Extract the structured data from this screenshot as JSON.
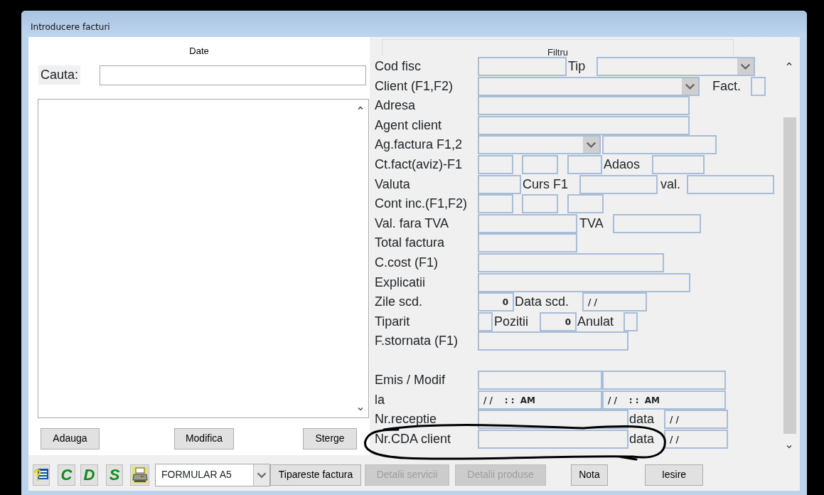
{
  "window": {
    "title": "Introducere facturi"
  },
  "tabs": [
    {
      "label": "Date",
      "selected": true
    },
    {
      "label": "Filtru",
      "selected": false
    }
  ],
  "search": {
    "label": "Cauta:"
  },
  "list_buttons": [
    {
      "label": "Adauga"
    },
    {
      "label": "Modifica"
    },
    {
      "label": "Sterge"
    }
  ],
  "form": {
    "sections": [
      {
        "rows": [
          {
            "label": "Cod fisc",
            "items": [
              {
                "kind": "field"
              },
              {
                "kind": "label",
                "text": "Tip"
              },
              {
                "kind": "combo"
              }
            ]
          },
          {
            "label": "Client (F1,F2)",
            "items": [
              {
                "kind": "combo"
              },
              {
                "kind": "label",
                "text": "Fact."
              },
              {
                "kind": "field"
              }
            ]
          },
          {
            "label": "Adresa",
            "items": [
              {
                "kind": "field"
              }
            ]
          },
          {
            "label": "Agent client",
            "items": [
              {
                "kind": "field"
              }
            ]
          },
          {
            "label": "Ag.factura F1,2",
            "items": [
              {
                "kind": "combo"
              },
              {
                "kind": "field"
              }
            ]
          },
          {
            "label": "Ct.fact(aviz)-F1",
            "items": [
              {
                "kind": "field"
              },
              {
                "kind": "field"
              },
              {
                "kind": "field"
              },
              {
                "kind": "label",
                "text": "Adaos"
              },
              {
                "kind": "field"
              }
            ]
          },
          {
            "label": "Valuta",
            "items": [
              {
                "kind": "field"
              },
              {
                "kind": "label",
                "text": "Curs F1"
              },
              {
                "kind": "field"
              },
              {
                "kind": "label",
                "text": "val."
              },
              {
                "kind": "field"
              }
            ]
          },
          {
            "label": "Cont inc.(F1,F2)",
            "items": [
              {
                "kind": "field"
              },
              {
                "kind": "field"
              },
              {
                "kind": "field"
              }
            ]
          },
          {
            "label": "Val. fara TVA",
            "items": [
              {
                "kind": "field"
              },
              {
                "kind": "label",
                "text": "TVA"
              },
              {
                "kind": "field"
              }
            ]
          },
          {
            "label": "Total factura",
            "items": [
              {
                "kind": "field"
              }
            ]
          },
          {
            "label": "C.cost (F1)",
            "items": [
              {
                "kind": "field"
              }
            ]
          },
          {
            "label": "Explicatii",
            "items": [
              {
                "kind": "field"
              }
            ]
          },
          {
            "label": "Zile scd.",
            "items": [
              {
                "kind": "number",
                "value": "0"
              },
              {
                "kind": "label",
                "text": "Data scd."
              },
              {
                "kind": "field",
                "value": "/ /"
              }
            ]
          },
          {
            "label": "Tiparit",
            "items": [
              {
                "kind": "field"
              },
              {
                "kind": "label",
                "text": "Pozitii"
              },
              {
                "kind": "number",
                "value": "0"
              },
              {
                "kind": "label",
                "text": "Anulat"
              },
              {
                "kind": "field"
              }
            ]
          },
          {
            "label": "F.stornata (F1)",
            "items": [
              {
                "kind": "field"
              }
            ]
          }
        ]
      },
      {
        "rows": [
          {
            "label": "Emis / Modif",
            "items": [
              {
                "kind": "field"
              },
              {
                "kind": "field"
              }
            ]
          },
          {
            "label": "la",
            "items": [
              {
                "kind": "field",
                "value": "/ /    : :  AM"
              },
              {
                "kind": "field",
                "value": "/ /    : :  AM"
              }
            ]
          },
          {
            "label": "Nr.receptie",
            "items": [
              {
                "kind": "field"
              },
              {
                "kind": "label",
                "text": "data"
              },
              {
                "kind": "field",
                "value": "/ /"
              }
            ]
          },
          {
            "label": "Nr.CDA client",
            "items": [
              {
                "kind": "field"
              },
              {
                "kind": "label",
                "text": "data"
              },
              {
                "kind": "field",
                "value": "/ /"
              }
            ]
          }
        ]
      }
    ]
  },
  "toolbar": [
    {
      "kind": "help-tool"
    },
    {
      "kind": "letter",
      "text": "C"
    },
    {
      "kind": "letter",
      "text": "D"
    },
    {
      "kind": "letter",
      "text": "S"
    },
    {
      "kind": "print-tool"
    },
    {
      "kind": "combo",
      "value": "FORMULAR A5"
    },
    {
      "kind": "button",
      "label": "Tipareste factura",
      "disabled": false
    },
    {
      "kind": "button",
      "label": "Detalii servicii",
      "disabled": true
    },
    {
      "kind": "button",
      "label": "Detalii produse",
      "disabled": true
    },
    {
      "kind": "button",
      "label": "Nota",
      "disabled": false
    },
    {
      "kind": "button",
      "label": "Iesire",
      "disabled": false
    }
  ]
}
